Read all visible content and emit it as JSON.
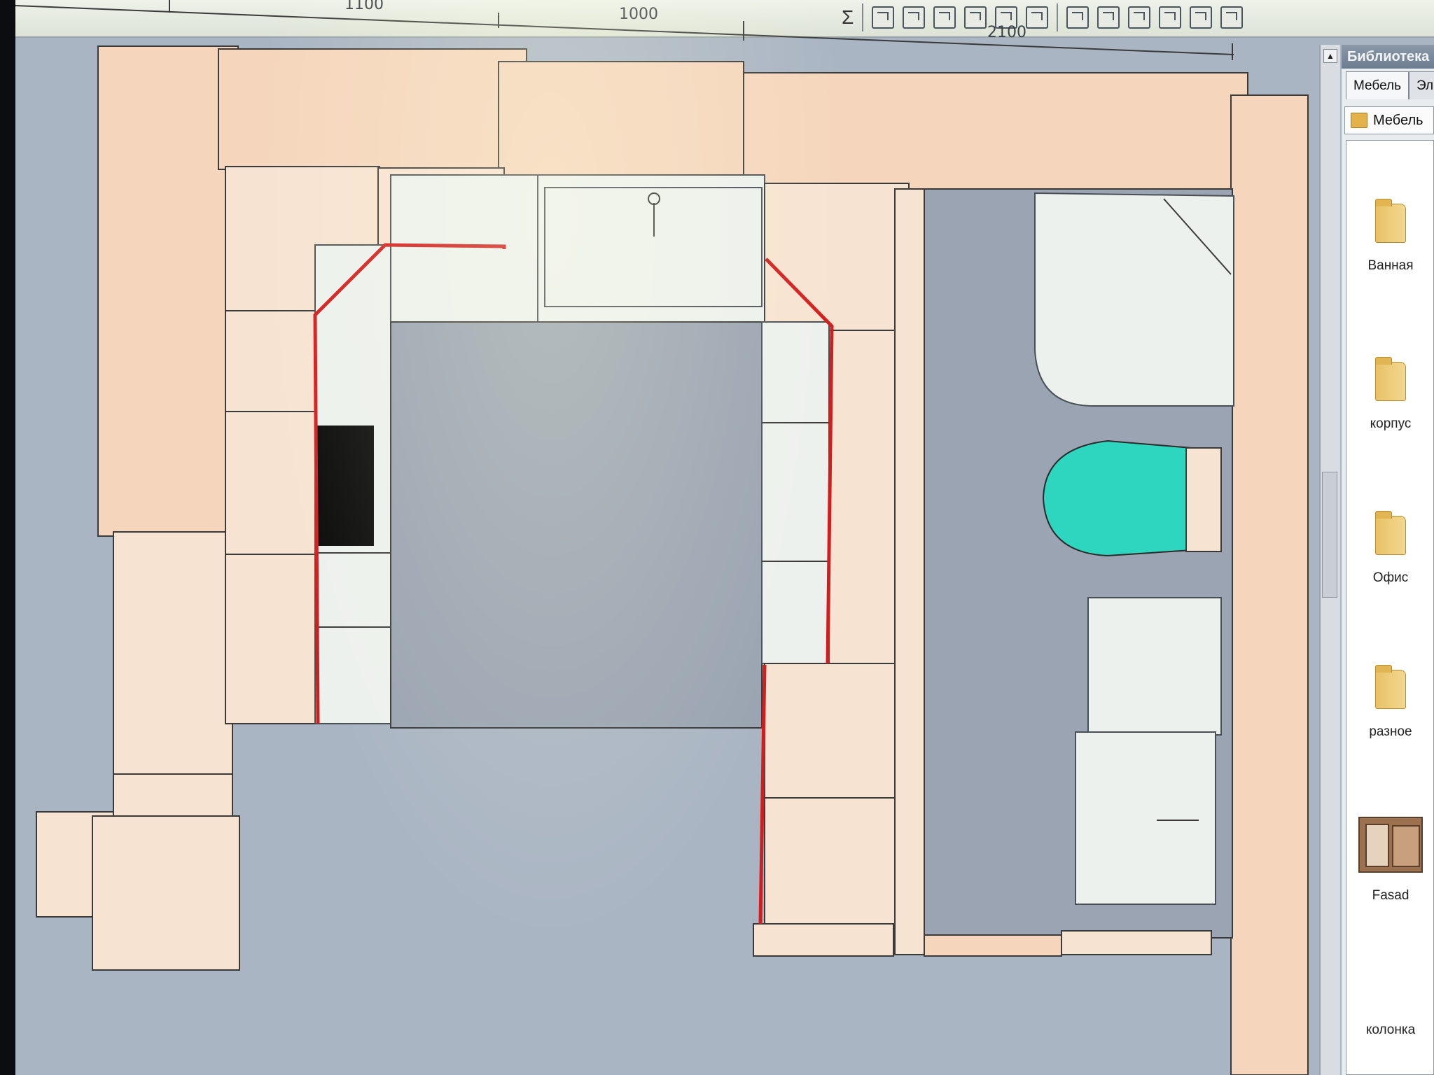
{
  "ruler": {
    "labels": [
      "1100",
      "1000",
      "2100"
    ]
  },
  "toolbar": {
    "sum_symbol": "Σ"
  },
  "library": {
    "title": "Библиотека",
    "tabs": [
      "Мебель",
      "Эле"
    ],
    "current_path": "Мебель",
    "items": [
      {
        "label": "Ванная",
        "icon": "folder-icon"
      },
      {
        "label": "корпус",
        "icon": "folder-icon"
      },
      {
        "label": "Офис",
        "icon": "folder-icon"
      },
      {
        "label": "разное",
        "icon": "folder-icon"
      },
      {
        "label": "Fasad",
        "icon": "model-thumbnail"
      },
      {
        "label": "колонка",
        "icon": "folder-icon"
      }
    ]
  },
  "colors": {
    "floor": "#9aa4b2",
    "panel_wood": "#f5d6bd",
    "edge_highlight": "#d21d1d",
    "toilet_seat": "#2fd6bf"
  }
}
